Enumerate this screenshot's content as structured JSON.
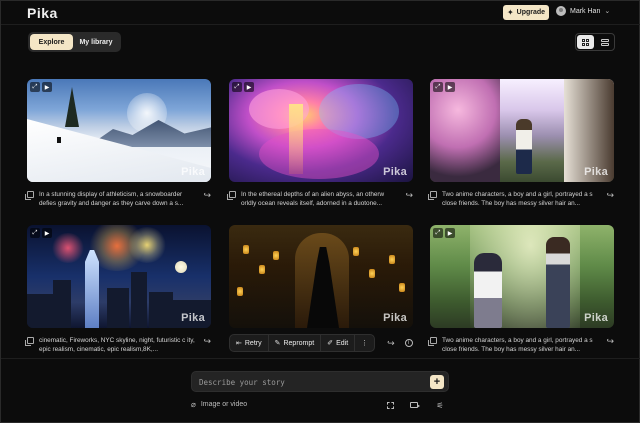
{
  "app": {
    "logo": "Pika"
  },
  "header": {
    "upgrade_label": "Upgrade",
    "upgrade_icon": "sparkle-icon",
    "user_name": "Mark Han"
  },
  "tabs": [
    {
      "label": "Explore",
      "active": true
    },
    {
      "label": "My library",
      "active": false
    }
  ],
  "view_toggle": {
    "options": [
      "grid-view",
      "list-view"
    ],
    "selected": "grid-view"
  },
  "colors": {
    "accent": "#f4e6c6",
    "background": "#0c0c0c"
  },
  "videos": [
    {
      "watermark": "Pika",
      "caption": "In a stunning display of athleticism, a snowboarder defies gravity and danger as they carve down a s..."
    },
    {
      "watermark": "Pika",
      "caption": "In the ethereal depths of an alien abyss, an otherw orldly ocean reveals itself, adorned in a duotone..."
    },
    {
      "watermark": "Pika",
      "caption": "Two anime characters, a boy and a girl, portrayed a s close friends. The boy has messy silver hair an..."
    },
    {
      "watermark": "Pika",
      "caption": "cinematic, Fireworks, NYC skyline, night, futuristic c ity, epic realism, cinematic, epic realism,8K,..."
    },
    {
      "watermark": "Pika",
      "caption": ""
    },
    {
      "watermark": "Pika",
      "caption": "Two anime characters, a boy and a girl, portrayed a s close friends. The boy has messy silver hair an..."
    }
  ],
  "video_actions": {
    "retry": "Retry",
    "reprompt": "Reprompt",
    "edit": "Edit"
  },
  "composer": {
    "placeholder": "Describe your story",
    "attach_label": "Image or video"
  }
}
